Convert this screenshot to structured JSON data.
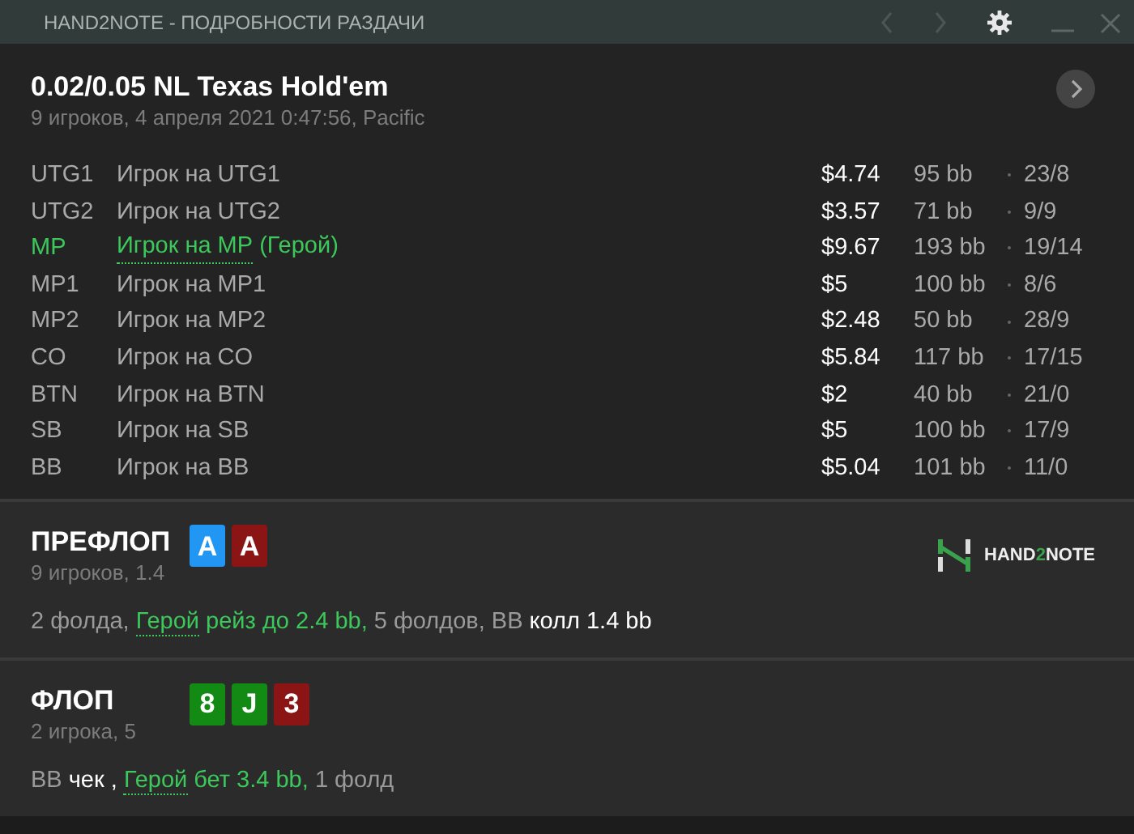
{
  "window": {
    "title": "HAND2NOTE - ПОДРОБНОСТИ РАЗДАЧИ"
  },
  "hand": {
    "title": "0.02/0.05 NL Texas Hold'em",
    "subtitle": "9 игроков, 4 апреля 2021 0:47:56, Pacific"
  },
  "players": [
    {
      "position": "UTG1",
      "name": "Игрок на UTG1",
      "hero": false,
      "stack": "$4.74",
      "bb": "95 bb",
      "stats": "23/8"
    },
    {
      "position": "UTG2",
      "name": "Игрок на UTG2",
      "hero": false,
      "stack": "$3.57",
      "bb": "71 bb",
      "stats": "9/9"
    },
    {
      "position": "MP",
      "name": "Игрок на MP",
      "hero_tag": "(Герой)",
      "hero": true,
      "stack": "$9.67",
      "bb": "193 bb",
      "stats": "19/14"
    },
    {
      "position": "MP1",
      "name": "Игрок на MP1",
      "hero": false,
      "stack": "$5",
      "bb": "100 bb",
      "stats": "8/6"
    },
    {
      "position": "MP2",
      "name": "Игрок на MP2",
      "hero": false,
      "stack": "$2.48",
      "bb": "50 bb",
      "stats": "28/9"
    },
    {
      "position": "CO",
      "name": "Игрок на CO",
      "hero": false,
      "stack": "$5.84",
      "bb": "117 bb",
      "stats": "17/15"
    },
    {
      "position": "BTN",
      "name": "Игрок на BTN",
      "hero": false,
      "stack": "$2",
      "bb": "40 bb",
      "stats": "21/0"
    },
    {
      "position": "SB",
      "name": "Игрок на SB",
      "hero": false,
      "stack": "$5",
      "bb": "100 bb",
      "stats": "17/9"
    },
    {
      "position": "BB",
      "name": "Игрок на BB",
      "hero": false,
      "stack": "$5.04",
      "bb": "101 bb",
      "stats": "11/0"
    }
  ],
  "streets": [
    {
      "name": "ПРЕФЛОП",
      "info": "9 игроков, 1.4",
      "logo": {
        "text_1": "HAND",
        "text_2": "2",
        "text_3": "NOTE"
      },
      "cards": [
        {
          "rank": "A",
          "color": "#2196f3"
        },
        {
          "rank": "A",
          "color": "#8b1414"
        }
      ],
      "actions": [
        {
          "kind": "plain",
          "text": "2 фолда,"
        },
        {
          "kind": "hero_name",
          "text": "Герой"
        },
        {
          "kind": "hero",
          "text": "рейз до 2.4 bb,"
        },
        {
          "kind": "plain",
          "text": "5 фолдов, BB"
        },
        {
          "kind": "action",
          "text": "колл 1.4 bb"
        }
      ]
    },
    {
      "name": "ФЛОП",
      "info": "2 игрока, 5",
      "cards": [
        {
          "rank": "8",
          "color": "#138a13"
        },
        {
          "rank": "J",
          "color": "#138a13"
        },
        {
          "rank": "3",
          "color": "#8b1414"
        }
      ],
      "actions": [
        {
          "kind": "plain",
          "text": "BB"
        },
        {
          "kind": "action",
          "text": "чек ,"
        },
        {
          "kind": "hero_name",
          "text": "Герой"
        },
        {
          "kind": "hero",
          "text": "бет 3.4 bb,"
        },
        {
          "kind": "plain",
          "text": "1 фолд"
        }
      ]
    }
  ]
}
